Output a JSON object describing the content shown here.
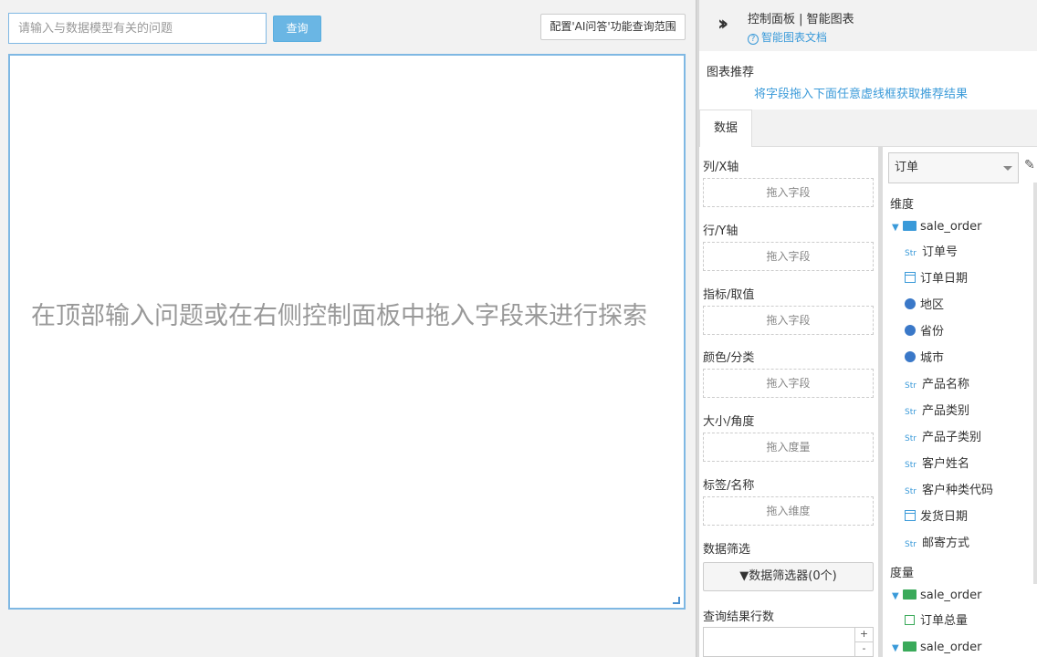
{
  "search": {
    "placeholder": "请输入与数据模型有关的问题",
    "query_label": "查询",
    "config_label": "配置'AI问答'功能查询范围"
  },
  "canvas": {
    "hint": "在顶部输入问题或在右侧控制面板中拖入字段来进行探索"
  },
  "panel": {
    "title": "控制面板 | 智能图表",
    "doc_link": "智能图表文档",
    "recommend_label": "图表推荐",
    "recommend_hint": "将字段拖入下面任意虚线框获取推荐结果",
    "tab_data": "数据"
  },
  "shelves": [
    {
      "label": "列/X轴",
      "drop": "拖入字段"
    },
    {
      "label": "行/Y轴",
      "drop": "拖入字段"
    },
    {
      "label": "指标/取值",
      "drop": "拖入字段"
    },
    {
      "label": "颜色/分类",
      "drop": "拖入字段"
    },
    {
      "label": "大小/角度",
      "drop": "拖入度量"
    },
    {
      "label": "标签/名称",
      "drop": "拖入维度"
    }
  ],
  "filter": {
    "label": "数据筛选",
    "button": "数据筛选器(0个)"
  },
  "rows": {
    "label": "查询结果行数",
    "plus": "+",
    "minus": "-"
  },
  "model": {
    "selected": "订单"
  },
  "dimensions": {
    "label": "维度",
    "folder": "sale_order",
    "fields": [
      {
        "type": "str",
        "name": "订单号"
      },
      {
        "type": "date",
        "name": "订单日期"
      },
      {
        "type": "geo",
        "name": "地区"
      },
      {
        "type": "geo",
        "name": "省份"
      },
      {
        "type": "geo",
        "name": "城市"
      },
      {
        "type": "str",
        "name": "产品名称"
      },
      {
        "type": "str",
        "name": "产品类别"
      },
      {
        "type": "str",
        "name": "产品子类别"
      },
      {
        "type": "str",
        "name": "客户姓名"
      },
      {
        "type": "str",
        "name": "客户种类代码"
      },
      {
        "type": "date",
        "name": "发货日期"
      },
      {
        "type": "str",
        "name": "邮寄方式"
      }
    ]
  },
  "measures": {
    "label": "度量",
    "folder": "sale_order",
    "fields": [
      {
        "type": "measure",
        "name": "订单总量"
      }
    ],
    "folder2": "sale_order"
  },
  "icons": {
    "str_text": "Str"
  }
}
